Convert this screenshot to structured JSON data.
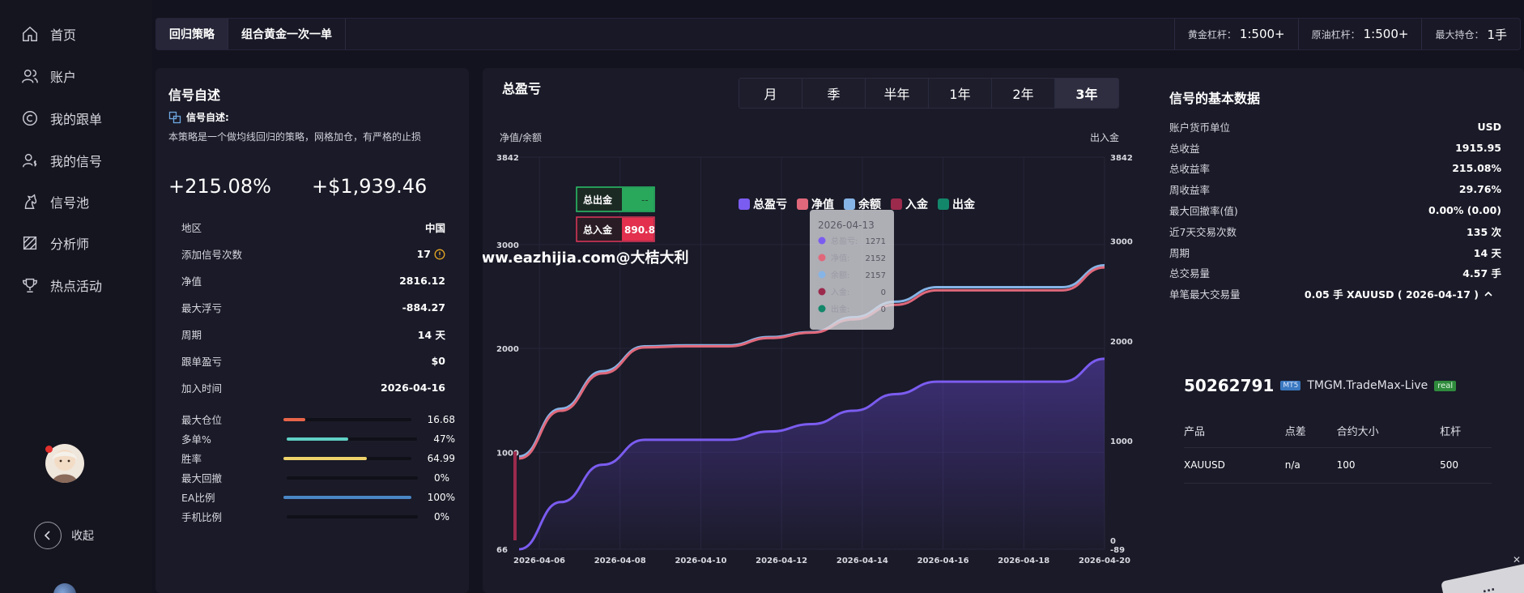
{
  "sidebar": {
    "items": [
      {
        "label": "首页",
        "icon": "home-icon"
      },
      {
        "label": "账户",
        "icon": "users-icon"
      },
      {
        "label": "我的跟单",
        "icon": "copyright-icon"
      },
      {
        "label": "我的信号",
        "icon": "user-dollar-icon"
      },
      {
        "label": "信号池",
        "icon": "horse-icon"
      },
      {
        "label": "分析师",
        "icon": "analyst-icon"
      },
      {
        "label": "热点活动",
        "icon": "trophy-icon"
      }
    ],
    "collapse_label": "收起"
  },
  "topbar": {
    "tabs": [
      {
        "label": "回归策略",
        "active": true
      },
      {
        "label": "组合黄金一次一单",
        "active": false
      }
    ],
    "leverages": [
      {
        "label": "黄金杠杆：",
        "value": "1:500+"
      },
      {
        "label": "原油杠杆：",
        "value": "1:500+"
      },
      {
        "label": "最大持仓：",
        "value": "1手"
      }
    ]
  },
  "left": {
    "title": "信号自述",
    "sub_title": "信号自述:",
    "description": "本策略是一个做均线回归的策略，网格加仓，有严格的止损",
    "return_pct": "+215.08%",
    "profit": "+$1,939.46",
    "rows": [
      {
        "k": "地区",
        "v": "中国"
      },
      {
        "k": "添加信号次数",
        "v": "17"
      },
      {
        "k": "净值",
        "v": "2816.12"
      },
      {
        "k": "最大浮亏",
        "v": "-884.27"
      },
      {
        "k": "周期",
        "v": "14 天"
      },
      {
        "k": "跟单盈亏",
        "v": "$0"
      },
      {
        "k": "加入时间",
        "v": "2026-04-16"
      }
    ],
    "bars": [
      {
        "k": "最大仓位",
        "v": "16.68",
        "fill": 0.17,
        "color": "#e8654a"
      },
      {
        "k": "多单%",
        "v": "47%",
        "fill": 0.47,
        "color": "#5fd0c4"
      },
      {
        "k": "胜率",
        "v": "64.99",
        "fill": 0.65,
        "color": "#efd36a"
      },
      {
        "k": "最大回撤",
        "v": "0%",
        "fill": 0.0,
        "color": "#888888"
      },
      {
        "k": "EA比例",
        "v": "100%",
        "fill": 1.0,
        "color": "#4a87c6"
      },
      {
        "k": "手机比例",
        "v": "0%",
        "fill": 0.0,
        "color": "#888888"
      }
    ]
  },
  "mid": {
    "title": "总盈亏",
    "periods": [
      {
        "label": "月",
        "active": false
      },
      {
        "label": "季",
        "active": false
      },
      {
        "label": "半年",
        "active": false
      },
      {
        "label": "1年",
        "active": false
      },
      {
        "label": "2年",
        "active": false
      },
      {
        "label": "3年",
        "active": true
      }
    ],
    "watermark": "www.eazhijia.com@大桔大利",
    "badge_out": {
      "label": "总出金",
      "value": "--"
    },
    "badge_in": {
      "label": "总入金",
      "value": "890.8"
    },
    "tooltip": {
      "date": "2026-04-13",
      "rows": [
        {
          "k": "总盈亏:",
          "v": "1271"
        },
        {
          "k": "净值:",
          "v": "2152"
        },
        {
          "k": "余额:",
          "v": "2157"
        },
        {
          "k": "入金:",
          "v": "0"
        },
        {
          "k": "出金:",
          "v": "0"
        }
      ]
    }
  },
  "chart_data": {
    "type": "line",
    "ylabel_left": "净值/余额",
    "ylabel_right": "出入金",
    "left_ticks": [
      "3842",
      "3000",
      "2000",
      "1000",
      "66"
    ],
    "right_ticks": [
      "3842",
      "3000",
      "2000",
      "1000",
      "0",
      "-89"
    ],
    "x_ticks": [
      "2026-04-06",
      "2026-04-08",
      "2026-04-10",
      "2026-04-12",
      "2026-04-14",
      "2026-04-16",
      "2026-04-18",
      "2026-04-20"
    ],
    "x": [
      0,
      1,
      2,
      3,
      4,
      5,
      6,
      7,
      8,
      9,
      10,
      11,
      12,
      13,
      14
    ],
    "series": [
      {
        "name": "总盈亏",
        "color": "#7b5cf0",
        "values": [
          66,
          520,
          880,
          1120,
          1120,
          1120,
          1200,
          1271,
          1400,
          1560,
          1680,
          1680,
          1680,
          1680,
          1900
        ]
      },
      {
        "name": "净值",
        "color": "#e0687a",
        "values": [
          940,
          1400,
          1760,
          2010,
          2020,
          2020,
          2100,
          2152,
          2280,
          2420,
          2560,
          2560,
          2560,
          2560,
          2780
        ]
      },
      {
        "name": "余额",
        "color": "#86b4e6",
        "values": [
          960,
          1420,
          1780,
          2020,
          2030,
          2030,
          2110,
          2157,
          2300,
          2450,
          2590,
          2590,
          2590,
          2590,
          2800
        ]
      },
      {
        "name": "入金",
        "color": "#9b2a4c",
        "values": [
          890.8,
          0,
          0,
          0,
          0,
          0,
          0,
          0,
          0,
          0,
          0,
          0,
          0,
          0,
          0
        ]
      },
      {
        "name": "出金",
        "color": "#13876a",
        "values": [
          0,
          0,
          0,
          0,
          0,
          0,
          0,
          0,
          0,
          0,
          0,
          0,
          0,
          0,
          0
        ]
      }
    ],
    "ylim_left": [
      66,
      3842
    ],
    "ylim_right": [
      -89,
      3842
    ],
    "legend_position": "top"
  },
  "right": {
    "title": "信号的基本数据",
    "rows": [
      {
        "k": "账户货币单位",
        "v": "USD"
      },
      {
        "k": "总收益",
        "v": "1915.95"
      },
      {
        "k": "总收益率",
        "v": "215.08%"
      },
      {
        "k": "周收益率",
        "v": "29.76%"
      },
      {
        "k": "最大回撤率(值)",
        "v": "0.00% (0.00)"
      },
      {
        "k": "近7天交易次数",
        "v": "135 次"
      },
      {
        "k": "周期",
        "v": "14 天"
      },
      {
        "k": "总交易量",
        "v": "4.57 手"
      },
      {
        "k": "单笔最大交易量",
        "v": "0.05 手 XAUUSD ( 2026-04-17 )"
      }
    ],
    "account": {
      "number": "50262791",
      "platform": "MT5",
      "server": "TMGM.TradeMax-Live",
      "type": "real"
    },
    "table": {
      "headers": [
        "产品",
        "点差",
        "合约大小",
        "杠杆"
      ],
      "rows": [
        [
          "XAUUSD",
          "n/a",
          "100",
          "500"
        ]
      ]
    }
  }
}
